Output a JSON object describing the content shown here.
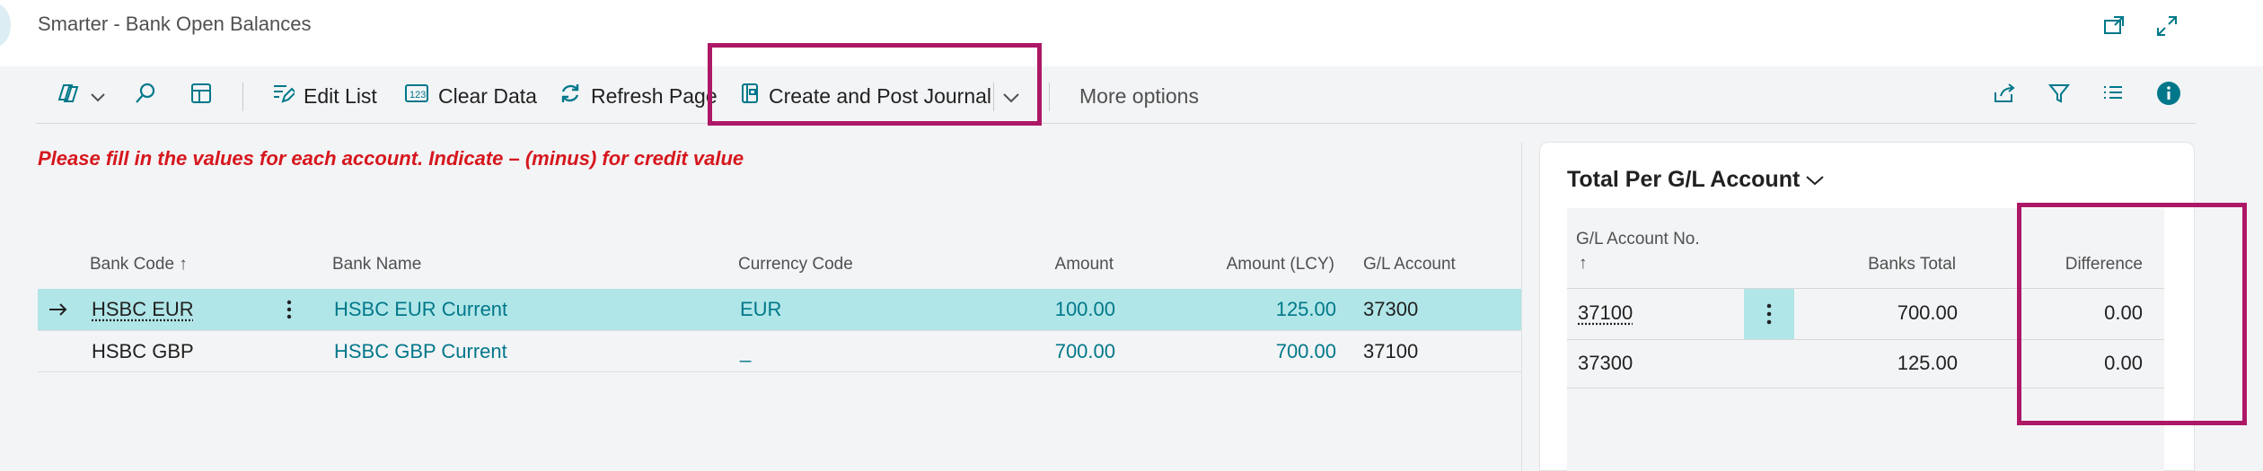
{
  "window": {
    "title": "Smarter - Bank Open Balances",
    "icons": [
      "open-in-new-window-icon",
      "expand-icon"
    ]
  },
  "commands": {
    "edit_list": "Edit List",
    "clear_data": "Clear Data",
    "refresh_page": "Refresh Page",
    "create_post": "Create and Post Journal",
    "more_options": "More options",
    "icons": [
      "copilot-icon",
      "search-icon",
      "layout-icon",
      "share-icon",
      "filter-icon",
      "list-view-icon",
      "info-icon"
    ]
  },
  "message": "Please fill in the values for each account. Indicate – (minus) for credit value",
  "table": {
    "columns": {
      "bank_code": "Bank Code",
      "sort_indicator": "↑",
      "bank_name": "Bank Name",
      "currency_code": "Currency Code",
      "amount": "Amount",
      "amount_lcy": "Amount (LCY)",
      "gl_account": "G/L Account"
    },
    "rows": [
      {
        "bank_code": "HSBC EUR",
        "bank_name": "HSBC EUR Current",
        "currency_code": "EUR",
        "amount": "100.00",
        "amount_lcy": "125.00",
        "gl_account": "37300",
        "selected": true
      },
      {
        "bank_code": "HSBC GBP",
        "bank_name": "HSBC GBP Current",
        "currency_code": "_",
        "amount": "700.00",
        "amount_lcy": "700.00",
        "gl_account": "37100",
        "selected": false
      }
    ]
  },
  "factbox": {
    "title": "Total Per G/L Account",
    "columns": {
      "gl_account_no": "G/L Account No.",
      "sort_indicator": "↑",
      "banks_total": "Banks Total",
      "difference": "Difference"
    },
    "rows": [
      {
        "gl_account_no": "37100",
        "banks_total": "700.00",
        "difference": "0.00"
      },
      {
        "gl_account_no": "37300",
        "banks_total": "125.00",
        "difference": "0.00"
      }
    ]
  },
  "colors": {
    "accent": "#00788a",
    "highlight_box": "#ad1866",
    "selected_row": "#b1e6e8",
    "warning_text": "#d6171d"
  }
}
